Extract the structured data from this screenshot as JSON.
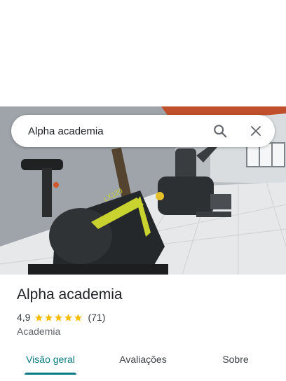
{
  "search": {
    "query": "Alpha academia"
  },
  "place": {
    "name": "Alpha academia",
    "rating": "4,9",
    "stars": 5,
    "review_count": "(71)",
    "category": "Academia"
  },
  "tabs": [
    {
      "label": "Visão geral",
      "active": true
    },
    {
      "label": "Avaliações",
      "active": false
    },
    {
      "label": "Sobre",
      "active": false
    }
  ],
  "photo": {
    "bike_model_text": "LX120"
  },
  "colors": {
    "accent": "#0b7b83",
    "star": "#fbbc04"
  }
}
